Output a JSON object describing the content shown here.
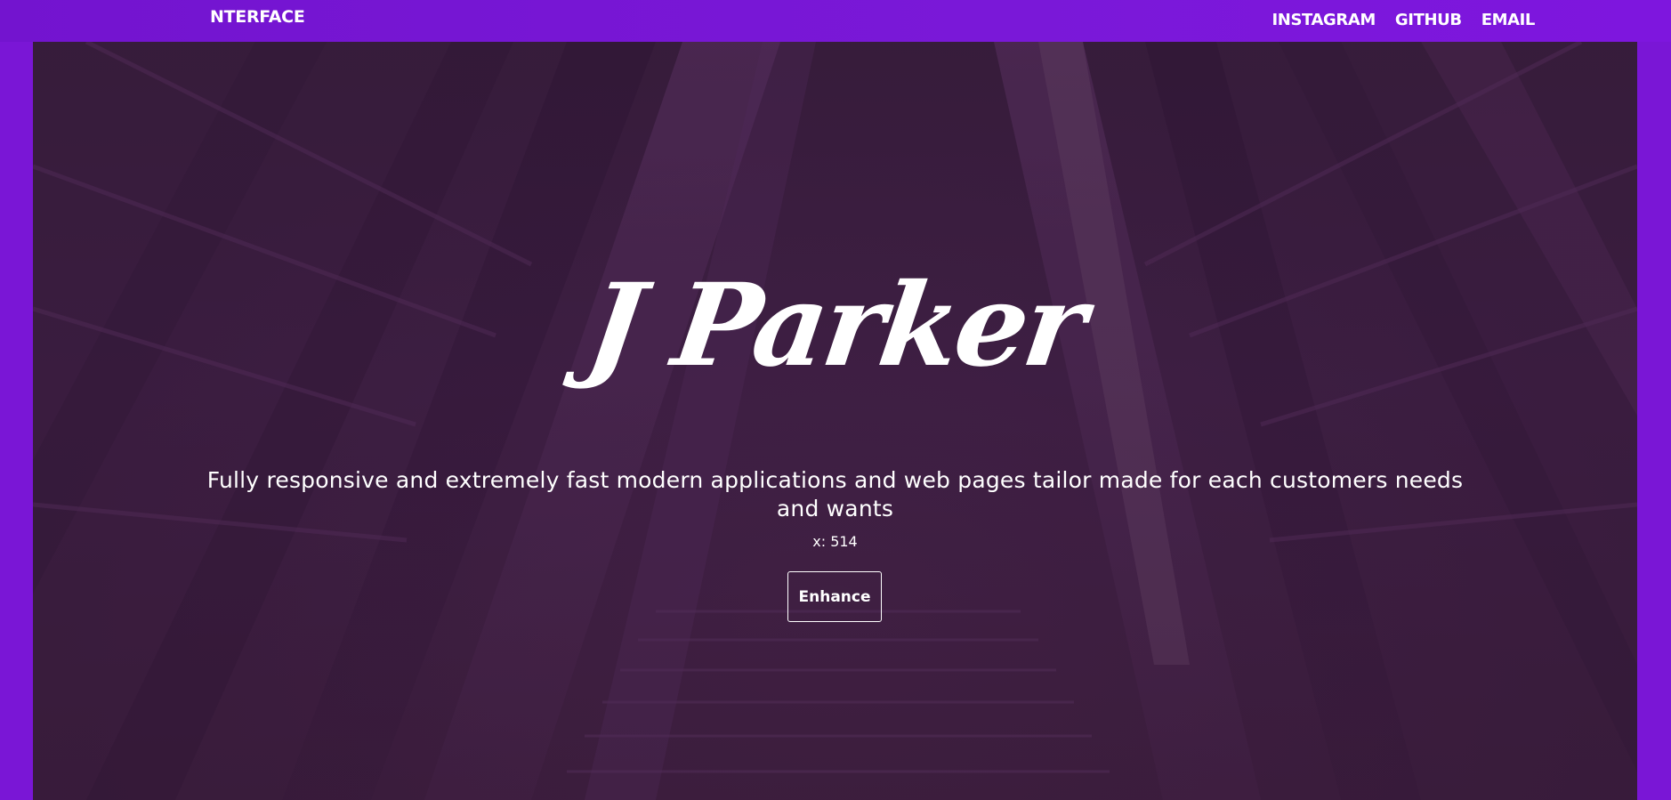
{
  "header": {
    "brand": "NTERFACE",
    "nav": [
      "INSTAGRAM",
      "GITHUB",
      "EMAIL"
    ]
  },
  "hero": {
    "title": "J Parker",
    "subtitle": "Fully responsive and extremely fast modern applications and web pages tailor made for each customers needs and wants",
    "coord_label": "x: 514",
    "button_label": "Enhance"
  },
  "colors": {
    "frame": "#7a16d6",
    "overlay": "#44224a",
    "text": "#ffffff"
  }
}
